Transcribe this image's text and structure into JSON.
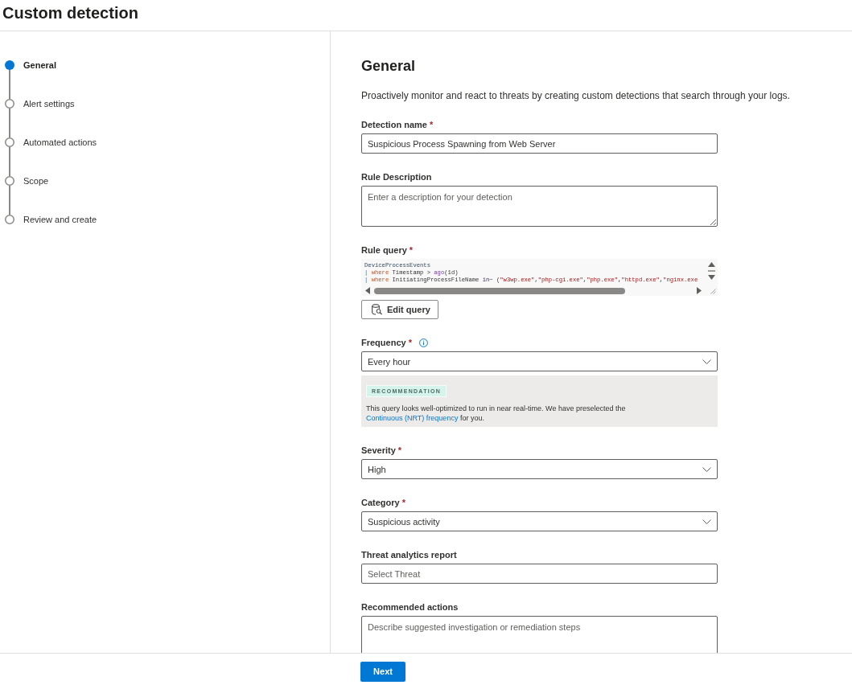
{
  "page": {
    "title": "Custom detection"
  },
  "steps": [
    {
      "label": "General",
      "selected": true
    },
    {
      "label": "Alert settings",
      "selected": false
    },
    {
      "label": "Automated actions",
      "selected": false
    },
    {
      "label": "Scope",
      "selected": false
    },
    {
      "label": "Review and create",
      "selected": false
    }
  ],
  "section": {
    "title": "General",
    "description": "Proactively monitor and react to threats by creating custom detections that search through your logs."
  },
  "fields": [
    {
      "kind": "text",
      "label": "Detection name",
      "required_mark": "*",
      "info": false,
      "value": "Suspicious Process Spawning from Web Server"
    },
    {
      "kind": "textarea",
      "label": "Rule Description",
      "info": false,
      "placeholder": "Enter a description for your detection"
    },
    {
      "kind": "query",
      "label": "Rule query",
      "required_mark": "*",
      "info": false,
      "code_lines": [
        [
          {
            "kind": "table",
            "text": "DeviceProcessEvents"
          }
        ],
        [
          {
            "kind": "pipe",
            "text": "|"
          },
          {
            "kind": "keyword",
            "text": " where"
          },
          {
            "kind": "plain",
            "text": " Timestamp > "
          },
          {
            "kind": "function",
            "text": "ago"
          },
          {
            "kind": "plain",
            "text": "(1d)"
          }
        ],
        [
          {
            "kind": "pipe",
            "text": "|"
          },
          {
            "kind": "keyword",
            "text": " where"
          },
          {
            "kind": "plain",
            "text": " InitiatingProcessFileName "
          },
          {
            "kind": "operator",
            "text": "in~"
          },
          {
            "kind": "plain",
            "text": " ("
          },
          {
            "kind": "string",
            "text": "\"w3wp.exe\""
          },
          {
            "kind": "plain",
            "text": ","
          },
          {
            "kind": "string",
            "text": "\"php-cgi.exe\""
          },
          {
            "kind": "plain",
            "text": ","
          },
          {
            "kind": "string",
            "text": "\"php.exe\""
          },
          {
            "kind": "plain",
            "text": ","
          },
          {
            "kind": "string",
            "text": "\"httpd.exe\""
          },
          {
            "kind": "plain",
            "text": ","
          },
          {
            "kind": "string",
            "text": "\"nginx.exe"
          }
        ]
      ],
      "button": "Edit query"
    },
    {
      "kind": "select",
      "label": "Frequency",
      "required_mark": "*",
      "info": true,
      "value": "Every hour",
      "recommendation": {
        "badge": "RECOMMENDATION",
        "text": "This query looks well-optimized to run in near real-time. We have preselected the ",
        "link": "Continuous (NRT) frequency",
        "text_after": " for you."
      }
    },
    {
      "kind": "select",
      "label": "Severity",
      "required_mark": "*",
      "info": false,
      "value": "High"
    },
    {
      "kind": "select",
      "label": "Category",
      "required_mark": "*",
      "info": false,
      "value": "Suspicious activity"
    },
    {
      "kind": "text",
      "label": "Threat analytics report",
      "info": false,
      "placeholder": "Select Threat"
    },
    {
      "kind": "textarea",
      "label": "Recommended actions",
      "info": false,
      "placeholder": "Describe suggested investigation or remediation steps"
    }
  ],
  "footer": {
    "button": "Next"
  }
}
